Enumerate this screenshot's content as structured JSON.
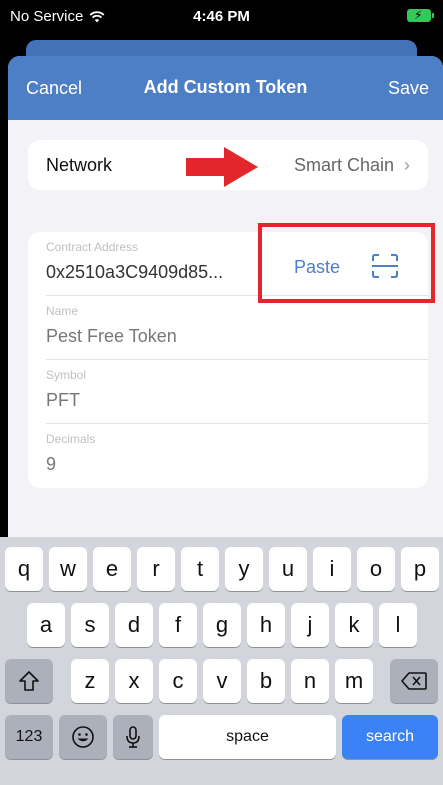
{
  "status_bar": {
    "carrier": "No Service",
    "time": "4:46 PM"
  },
  "nav": {
    "cancel_label": "Cancel",
    "title": "Add Custom Token",
    "save_label": "Save"
  },
  "network": {
    "label": "Network",
    "value": "Smart Chain"
  },
  "form": {
    "contract_address": {
      "label": "Contract Address",
      "value": "0x2510a3C9409d85...",
      "paste_label": "Paste"
    },
    "name": {
      "label": "Name",
      "value": "Pest Free Token"
    },
    "symbol": {
      "label": "Symbol",
      "value": "PFT"
    },
    "decimals": {
      "label": "Decimals",
      "value": "9"
    }
  },
  "keyboard": {
    "row1": [
      "q",
      "w",
      "e",
      "r",
      "t",
      "y",
      "u",
      "i",
      "o",
      "p"
    ],
    "row2": [
      "a",
      "s",
      "d",
      "f",
      "g",
      "h",
      "j",
      "k",
      "l"
    ],
    "row3": [
      "z",
      "x",
      "c",
      "v",
      "b",
      "n",
      "m"
    ],
    "numbers_label": "123",
    "space_label": "space",
    "search_label": "search"
  },
  "colors": {
    "nav_blue": "#4d7fc7",
    "annotation_red": "#e3262b",
    "search_key": "#3b82f6"
  }
}
